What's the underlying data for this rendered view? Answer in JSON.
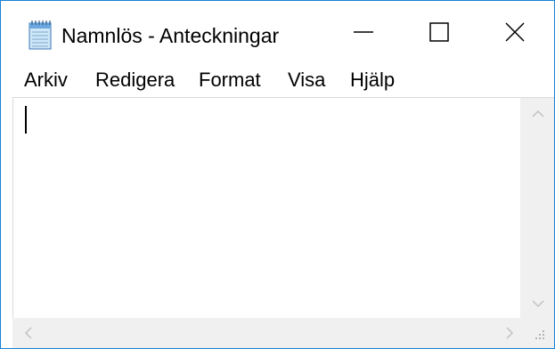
{
  "window": {
    "title": "Namnlös - Anteckningar",
    "app_icon": "notepad-icon",
    "caption_buttons": [
      "minimize-icon",
      "maximize-icon",
      "close-icon"
    ],
    "accent_color": "#1883d7"
  },
  "menubar": {
    "items": [
      "Arkiv",
      "Redigera",
      "Format",
      "Visa",
      "Hjälp"
    ]
  },
  "editor": {
    "content": ""
  },
  "scrollbars": {
    "vertical": [
      "scroll-up-icon",
      "scroll-down-icon"
    ],
    "horizontal": [
      "scroll-left-icon",
      "scroll-right-icon"
    ],
    "corner": "size-grip-icon"
  }
}
